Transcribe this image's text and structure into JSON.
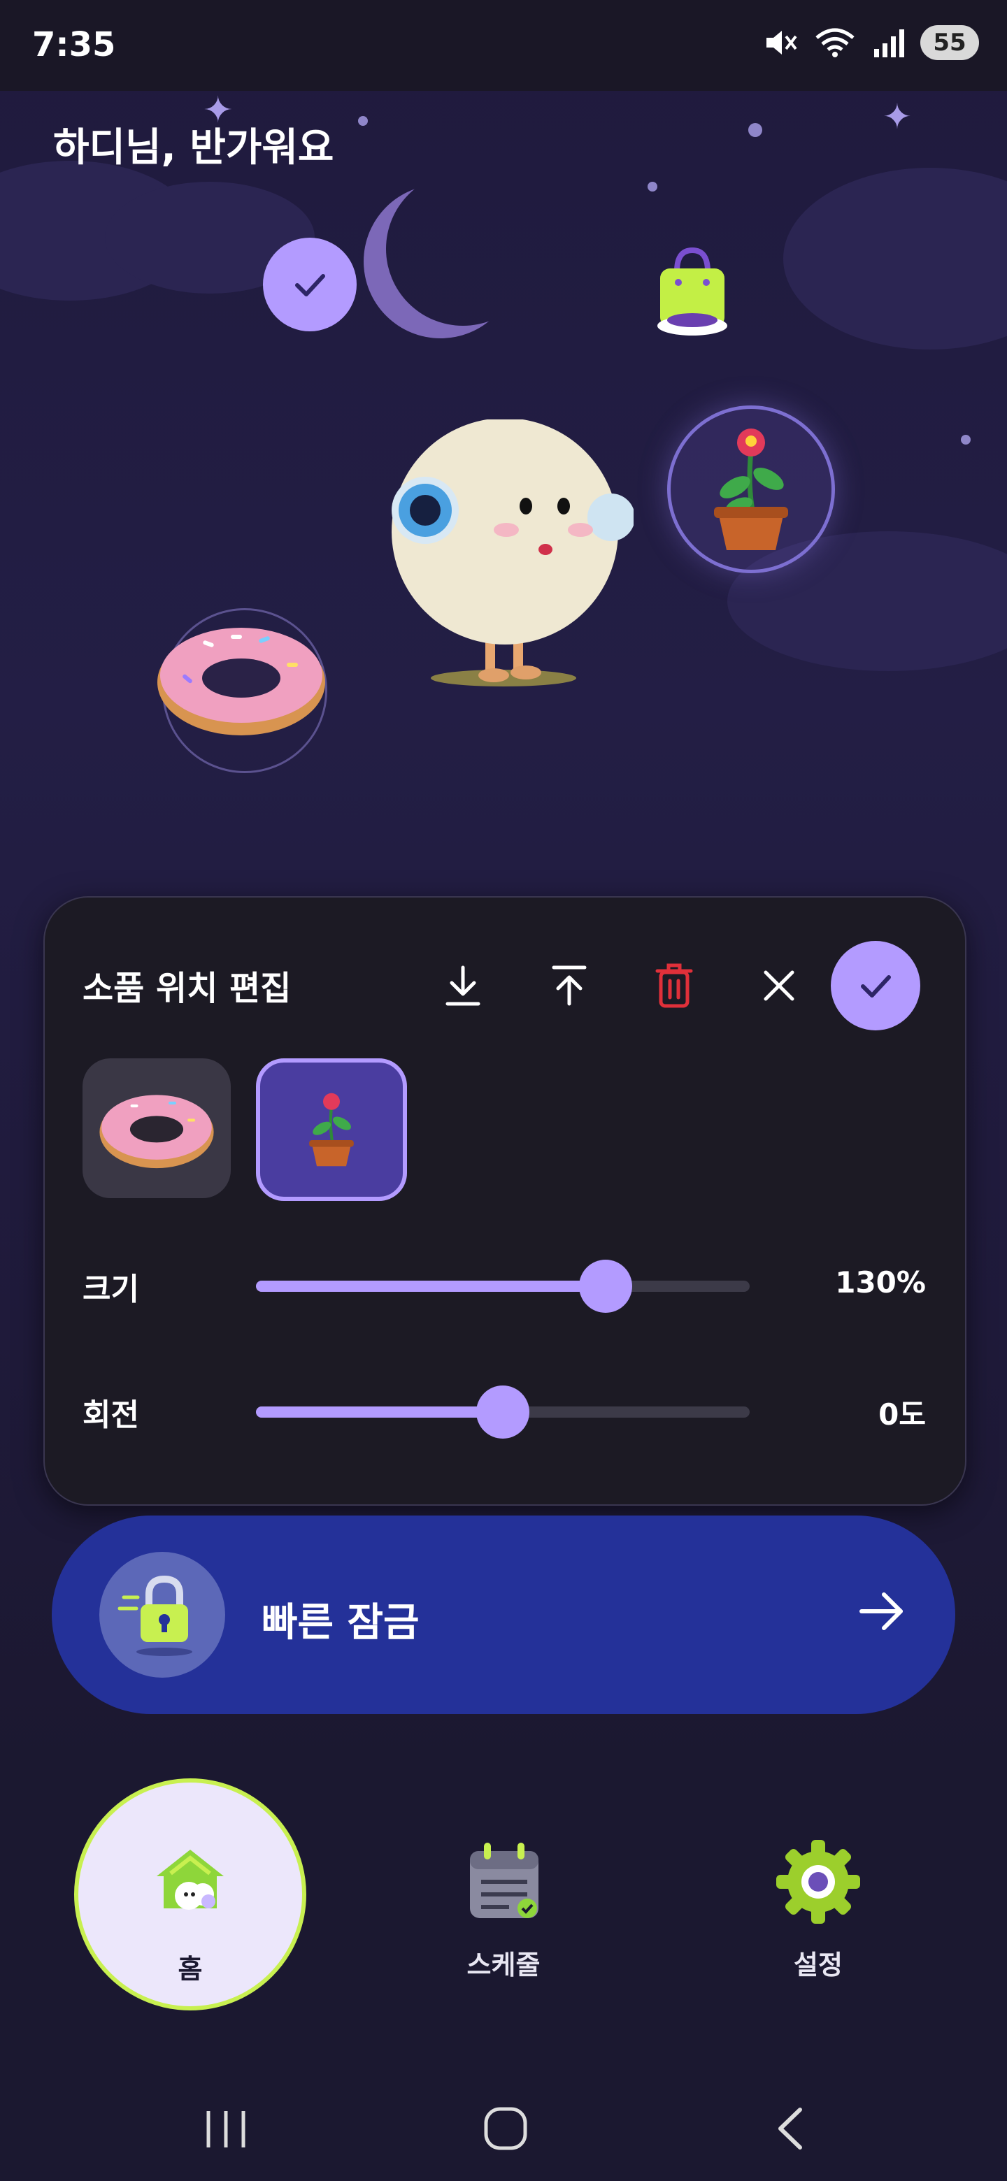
{
  "status_bar": {
    "time": "7:35",
    "battery": "55"
  },
  "greeting": "하디님, 반가워요",
  "editor": {
    "title": "소품 위치 편집",
    "size_label": "크기",
    "size_value": "130%",
    "size_level_percent": 71,
    "rotation_label": "회전",
    "rotation_value": "0도",
    "rotation_level_percent": 50,
    "items": [
      "donut",
      "potted-flower"
    ],
    "selected_item": "potted-flower"
  },
  "quick_lock": {
    "label": "빠른 잠금"
  },
  "bottom_nav": {
    "home": "홈",
    "schedule": "스케줄",
    "settings": "설정",
    "active": "home"
  },
  "colors": {
    "accent": "#b39bff",
    "lime": "#c8f050",
    "quick_lock_bg": "#243199",
    "delete_red": "#e0303a",
    "background": "#1b1830"
  }
}
